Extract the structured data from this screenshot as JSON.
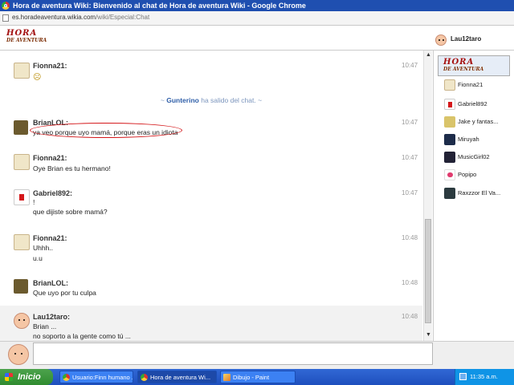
{
  "window": {
    "title": "Hora de aventura Wiki: Bienvenido al chat de Hora de aventura Wiki - Google Chrome",
    "url_host": "es.horadeaventura.wikia.com",
    "url_path": "/wiki/Especial:Chat"
  },
  "header": {
    "logo_line1": "HORA",
    "logo_line2": "DE AVENTURA",
    "current_user": "Lau12taro"
  },
  "messages": [
    {
      "user": "Fionna21:",
      "time": "10:47",
      "lines": [
        "☹"
      ]
    },
    {
      "user": "BrianLOL:",
      "time": "10:47",
      "lines": [
        "ya veo porque uyo mamá, porque eras un idiota"
      ]
    },
    {
      "user": "Fionna21:",
      "time": "10:47",
      "lines": [
        "Oye Brian es tu hermano!"
      ]
    },
    {
      "user": "Gabriel892:",
      "time": "10:47",
      "lines": [
        "!",
        "que dijiste sobre mamá?"
      ]
    },
    {
      "user": "Fionna21:",
      "time": "10:48",
      "lines": [
        "Uhhh..",
        "u.u"
      ]
    },
    {
      "user": "BrianLOL:",
      "time": "10:48",
      "lines": [
        "Que uyo por tu culpa"
      ]
    },
    {
      "user": "Lau12taro:",
      "time": "10:48",
      "lines": [
        "Brian ...",
        "no soporto a la gente como tú ..."
      ]
    }
  ],
  "inline_alert": {
    "tilde_left": "~",
    "name": "Gunterino",
    "text": "ha salido del chat.",
    "tilde_right": "~"
  },
  "sidebar": {
    "users": [
      "Fionna21",
      "Gabriel892",
      "Jake y fantas...",
      "Miruyah",
      "MusicGirl02",
      "Popipo",
      "Raxzzor El Va..."
    ]
  },
  "taskbar": {
    "start": "Inicio",
    "tasks": [
      "Usuario:Finn humano ...",
      "Hora de aventura Wi...",
      "Dibujo - Paint"
    ],
    "clock": "11:35 a.m."
  },
  "colors": {
    "titlebar": "#1f4fb0",
    "taskbar": "#2459c7",
    "start_button": "#3e9a3e",
    "alert_name": "#2e5ea8",
    "annotation_circle": "#d4171a"
  }
}
